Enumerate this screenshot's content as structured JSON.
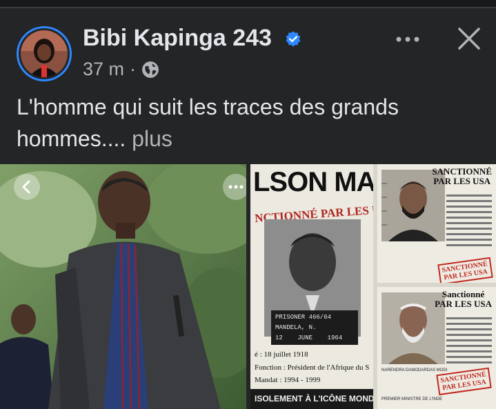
{
  "post": {
    "author": "Bibi Kapinga 243",
    "time": "37 m",
    "separator": "·",
    "caption": "L'homme qui suit les traces des grands hommes....",
    "see_more": "plus"
  },
  "icons": {
    "verified": "verified-badge-icon",
    "privacy": "globe-icon",
    "more": "more-options-icon",
    "close": "close-icon",
    "prev": "chevron-left-icon"
  },
  "colors": {
    "background": "#242526",
    "text": "#e4e6eb",
    "secondary": "#b0b3b8",
    "verified": "#2d88ff",
    "sanction_red": "#c0281f"
  },
  "collage": {
    "mandela_title": "LSON MAND",
    "mandela_banner": "NCTIONNÉ PAR LES USA",
    "mandela_board": "PRISONER 466/64\nMANDELA, N.\n12    JUNE    1964",
    "born": "é : 18 juillet 1918",
    "function": "Fonction : Président de l'Afrique du S",
    "mandate": "Mandat : 1994 - 1999",
    "mandela_footer": "ISOLEMENT À L'ICÔNE MONDIAL",
    "card_title": "SANCTIONNÉ\nPAR LES USA",
    "card_title_bottom": "Sanctionné\nPAR LES USA",
    "stamp_text": "SANCTIONNÉ\nPAR LES USA",
    "card_bottom_name": "NARENDRA DAMODARDAS MODI",
    "card_bottom_role": "PREMIER MINISTRE DE L'INDE"
  }
}
